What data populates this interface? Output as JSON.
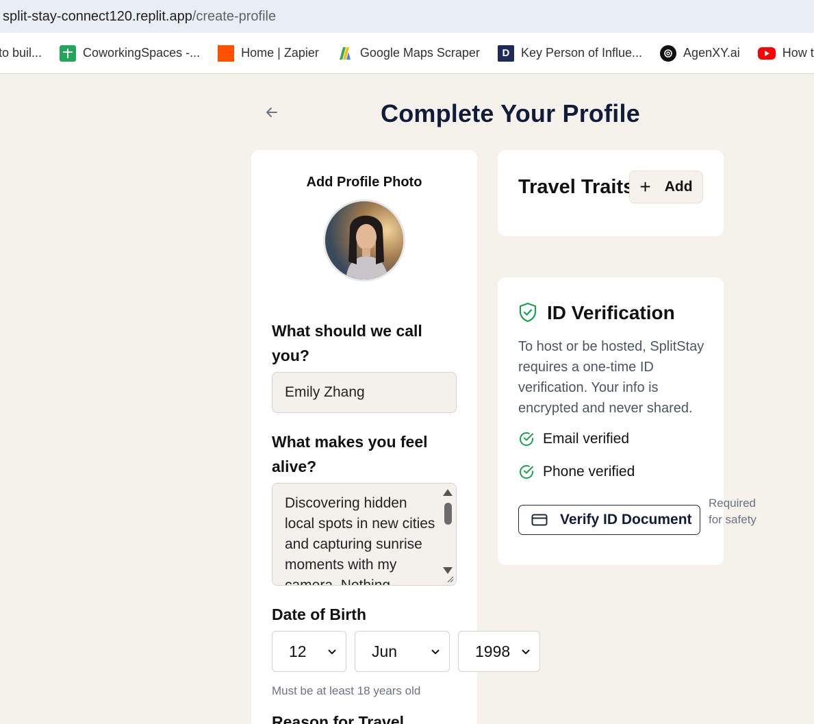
{
  "browser": {
    "url_host": "split-stay-connect120.replit.app",
    "url_path": "/create-profile",
    "bookmarks": [
      {
        "label": "to buil...",
        "icon": "none"
      },
      {
        "label": "CoworkingSpaces -...",
        "icon": "google-sheets-icon"
      },
      {
        "label": "Home | Zapier",
        "icon": "zapier-icon"
      },
      {
        "label": "Google Maps Scraper",
        "icon": "google-maps-icon"
      },
      {
        "label": "Key Person of Influe...",
        "icon": "d-logo-icon"
      },
      {
        "label": "AgenXY.ai",
        "icon": "openai-icon"
      },
      {
        "label": "How to B",
        "icon": "youtube-icon"
      }
    ]
  },
  "header": {
    "title": "Complete Your Profile"
  },
  "profile": {
    "photo_title": "Add Profile Photo",
    "name_label": "What should we call you?",
    "name_value": "Emily Zhang",
    "alive_label": "What makes you feel alive?",
    "alive_value": "Discovering hidden local spots in new cities and capturing sunrise moments with my camera. Nothing",
    "dob_label": "Date of Birth",
    "dob_day": "12",
    "dob_month": "Jun",
    "dob_year": "1998",
    "dob_helper": "Must be at least 18 years old",
    "reason_label": "Reason for Travel"
  },
  "traits": {
    "title": "Travel Traits",
    "add_label": "Add"
  },
  "verification": {
    "title": "ID Verification",
    "description": "To host or be hosted, SplitStay requires a one-time ID verification. Your info is encrypted and never shared.",
    "email_status": "Email verified",
    "phone_status": "Phone verified",
    "verify_button": "Verify ID Document",
    "required_note": "Required for safety"
  },
  "colors": {
    "background": "#f5f2ec",
    "title": "#101c3a",
    "verified_green": "#16a34a"
  }
}
